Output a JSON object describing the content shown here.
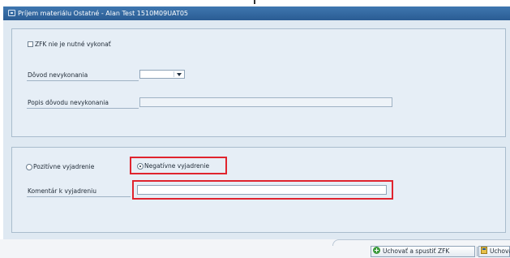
{
  "window": {
    "title": "Príjem materiálu Ostatné - Alan Test 1510M09UAT05"
  },
  "section_reason": {
    "checkbox_label": "ZFK nie je nutné vykonať",
    "checkbox_checked": false,
    "reason_label": "Dôvod nevykonania",
    "reason_value": "",
    "description_label": "Popis dôvodu nevykonania",
    "description_value": ""
  },
  "section_statement": {
    "positive_label": "Pozitívne vyjadrenie",
    "negative_label": "Negatívne vyjadrenie",
    "selected": "negative",
    "comment_label": "Komentár k vyjadreniu",
    "comment_value": ""
  },
  "footer": {
    "save_and_run_label": "Uchovať a spustiť ZFK",
    "save_label": "Uchovať"
  },
  "colors": {
    "title_bar": "#2a5c93",
    "panel_bg": "#dfe9f2",
    "highlight": "#e0242e"
  }
}
